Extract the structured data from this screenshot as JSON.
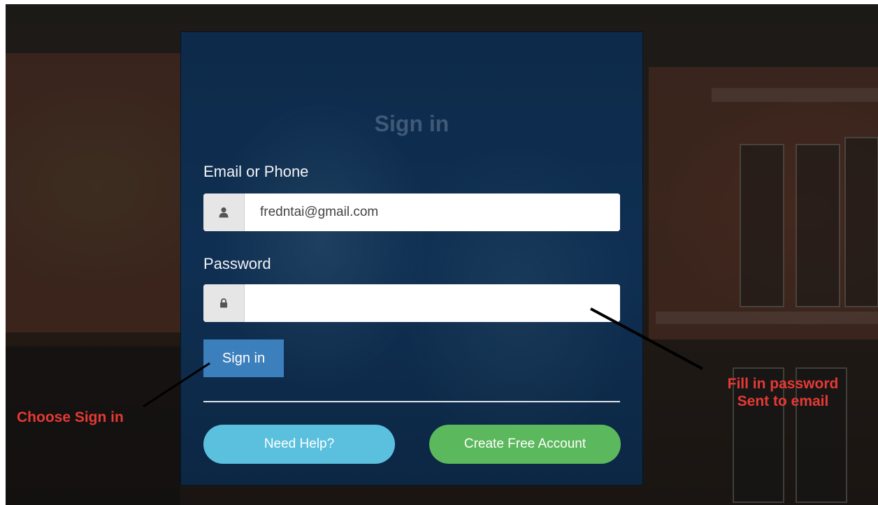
{
  "signin": {
    "title": "Sign in",
    "email_label": "Email or Phone",
    "email_value": "fredntai@gmail.com",
    "password_label": "Password",
    "password_value": "",
    "submit_label": "Sign in",
    "help_label": "Need Help?",
    "create_label": "Create Free Account"
  },
  "annotations": {
    "choose_sign_in": "Choose Sign in",
    "fill_password_line1": "Fill in password",
    "fill_password_line2": "Sent to email"
  },
  "icons": {
    "email_addon": "user-icon",
    "password_addon": "lock-icon"
  },
  "colors": {
    "panel": "#0f2f52",
    "sign_in_button": "#3c7fbd",
    "need_help_button": "#5bc0de",
    "create_account_button": "#5cb85c",
    "annotation_text": "#e53935"
  }
}
